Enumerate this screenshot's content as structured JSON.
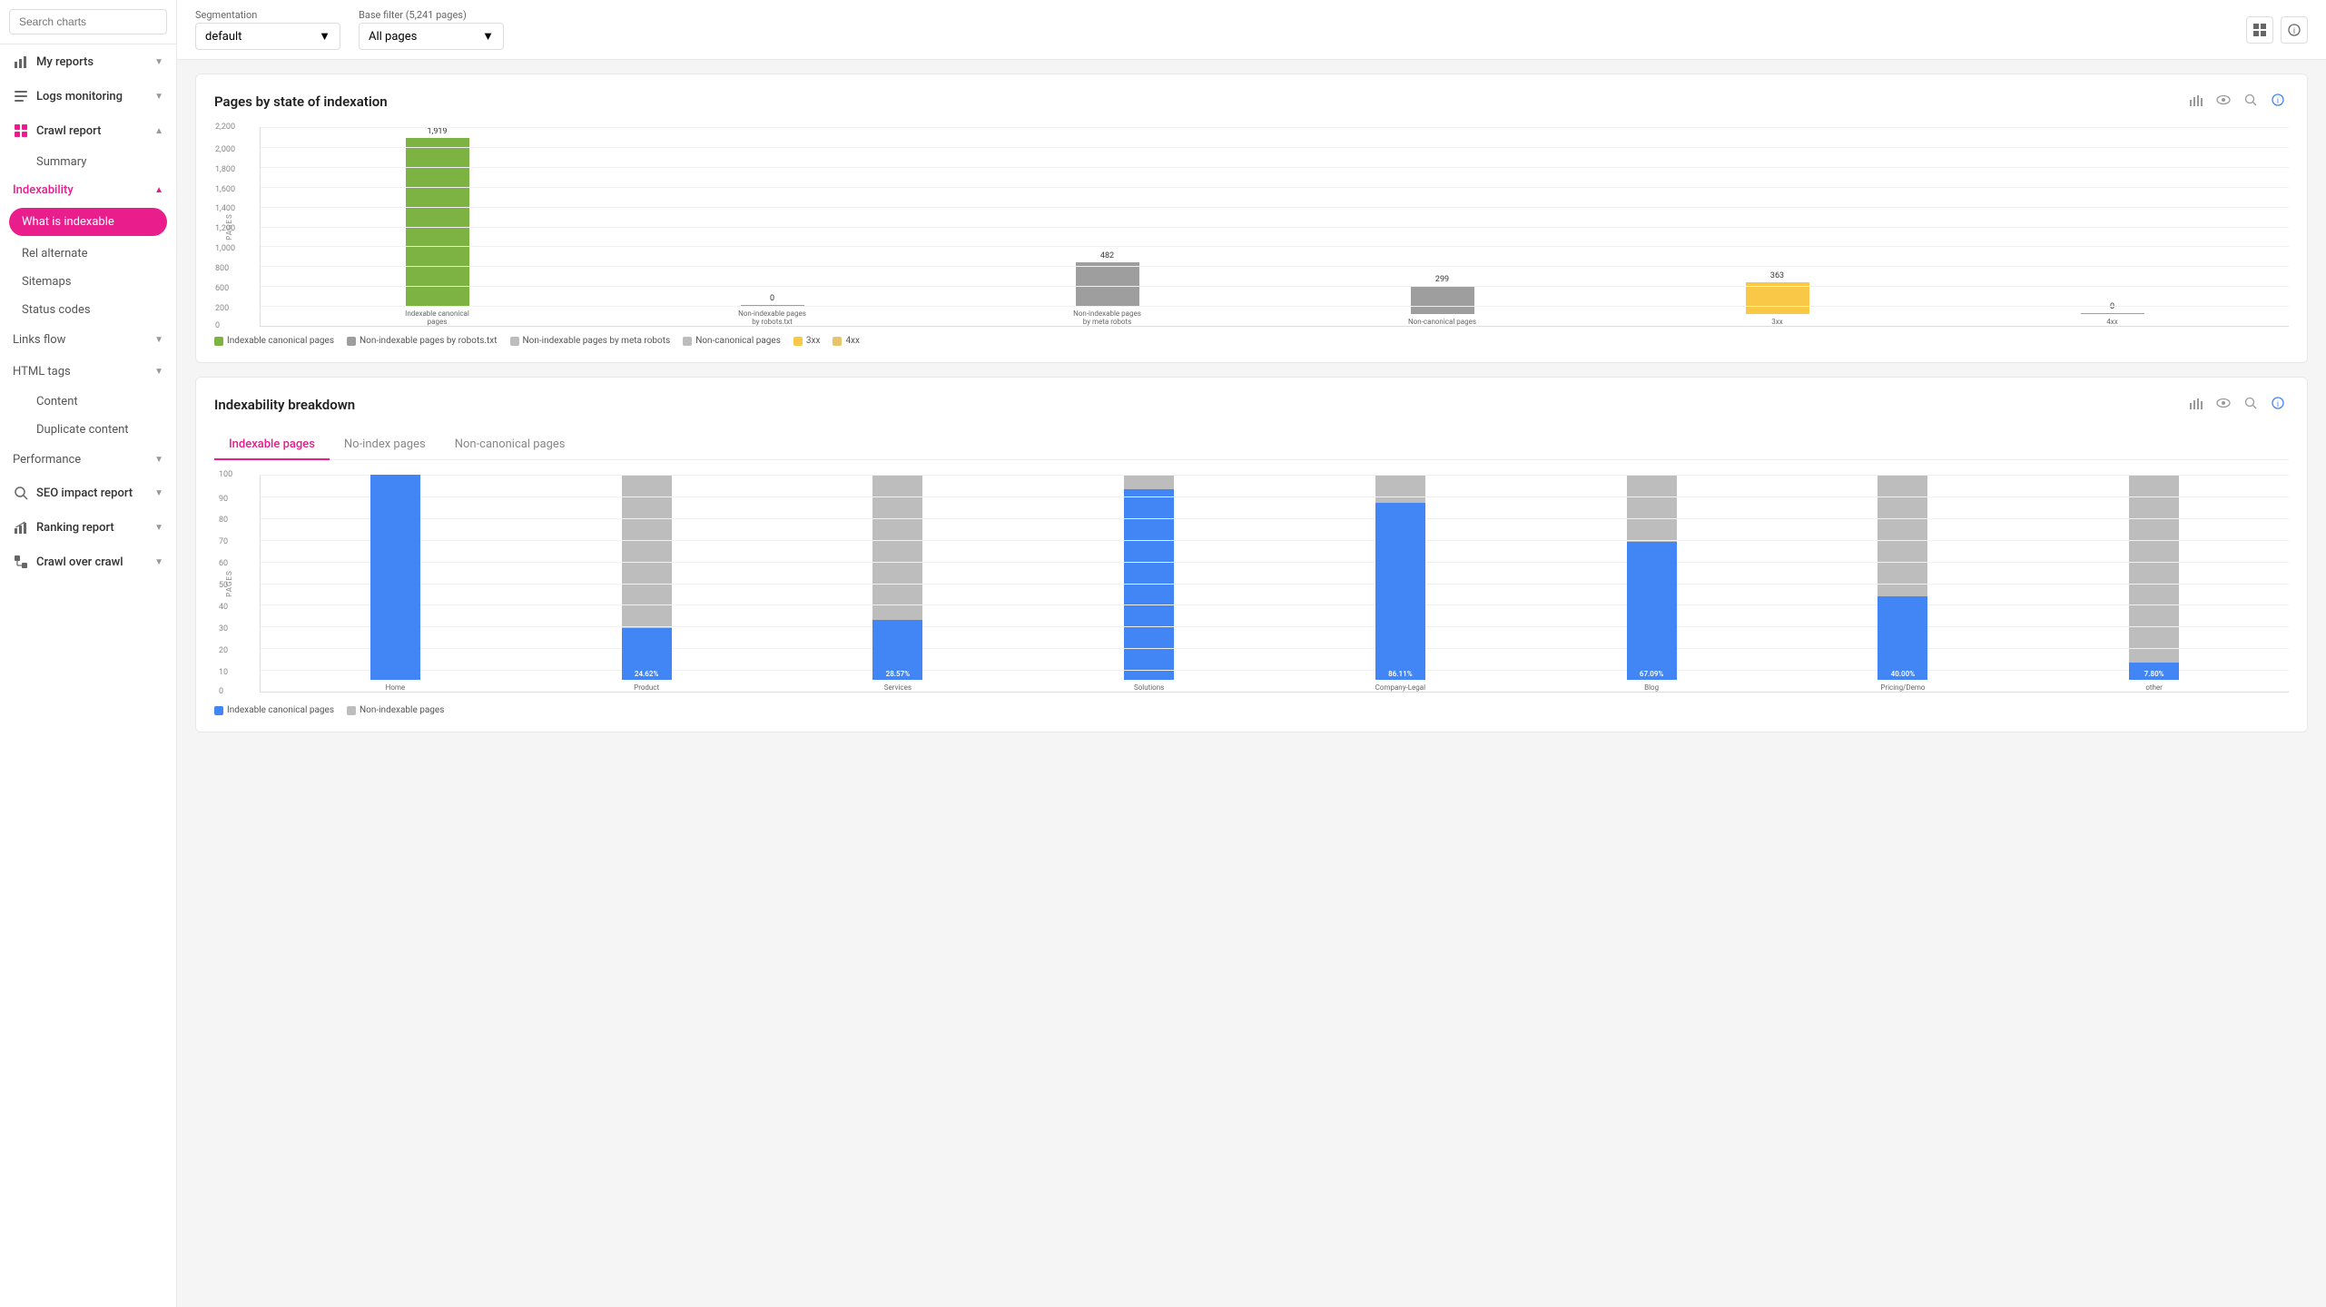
{
  "sidebar": {
    "search_placeholder": "Search charts",
    "nav_items": [
      {
        "id": "my-reports",
        "label": "My reports",
        "icon": "chart-icon",
        "has_children": true
      },
      {
        "id": "logs-monitoring",
        "label": "Logs monitoring",
        "icon": "logs-icon",
        "has_children": true
      },
      {
        "id": "crawl-report",
        "label": "Crawl report",
        "icon": "crawl-icon",
        "has_children": true,
        "expanded": true
      }
    ],
    "crawl_subitems": [
      {
        "id": "summary",
        "label": "Summary",
        "active": false
      },
      {
        "id": "indexability",
        "label": "Indexability",
        "active": true,
        "is_section": true
      },
      {
        "id": "what-is-indexable",
        "label": "What is indexable",
        "active": true,
        "pill": true
      },
      {
        "id": "rel-alternate",
        "label": "Rel alternate",
        "active": false
      },
      {
        "id": "sitemaps",
        "label": "Sitemaps",
        "active": false
      },
      {
        "id": "status-codes",
        "label": "Status codes",
        "active": false
      },
      {
        "id": "links-flow",
        "label": "Links flow",
        "has_children": true
      },
      {
        "id": "html-tags",
        "label": "HTML tags",
        "has_children": true
      },
      {
        "id": "content",
        "label": "Content"
      },
      {
        "id": "duplicate-content",
        "label": "Duplicate content"
      },
      {
        "id": "performance",
        "label": "Performance",
        "has_children": true
      },
      {
        "id": "seo-impact-report",
        "label": "SEO impact report",
        "icon": "seo-icon",
        "has_children": true
      },
      {
        "id": "ranking-report",
        "label": "Ranking report",
        "icon": "ranking-icon",
        "has_children": true
      },
      {
        "id": "crawl-over-crawl",
        "label": "Crawl over crawl",
        "icon": "crawl2-icon",
        "has_children": true
      }
    ]
  },
  "topbar": {
    "segmentation_label": "Segmentation",
    "segmentation_value": "default",
    "base_filter_label": "Base filter (5,241 pages)",
    "base_filter_value": "All pages",
    "icons": [
      "grid-icon",
      "info-icon"
    ]
  },
  "chart1": {
    "title": "Pages by state of indexation",
    "y_axis_title": "PAGES",
    "y_labels": [
      "0",
      "200",
      "400",
      "600",
      "800",
      "1,000",
      "1,200",
      "1,400",
      "1,600",
      "1,800",
      "2,000",
      "2,200"
    ],
    "bars": [
      {
        "label": "Indexable canonical pages",
        "value": 1919,
        "display": "1,919",
        "color": "#7cb342",
        "height_pct": 87
      },
      {
        "label": "Non-indexable pages by robots.txt",
        "value": 0,
        "display": "0",
        "color": "#9e9e9e",
        "height_pct": 0
      },
      {
        "label": "Non-indexable pages by meta robots",
        "value": 482,
        "display": "482",
        "color": "#9e9e9e",
        "height_pct": 22
      },
      {
        "label": "Non-canonical pages",
        "value": 299,
        "display": "299",
        "color": "#9e9e9e",
        "height_pct": 14
      },
      {
        "label": "3xx",
        "value": 363,
        "display": "363",
        "color": "#f9c846",
        "height_pct": 16
      },
      {
        "label": "4xx",
        "value": 0,
        "display": "0",
        "color": "#9e9e9e",
        "height_pct": 0
      }
    ],
    "legend": [
      {
        "label": "Indexable canonical pages",
        "color": "#7cb342"
      },
      {
        "label": "Non-indexable pages by robots.txt",
        "color": "#9e9e9e"
      },
      {
        "label": "Non-indexable pages by meta robots",
        "color": "#bdbdbd"
      },
      {
        "label": "Non-canonical pages",
        "color": "#bdbdbd"
      },
      {
        "label": "3xx",
        "color": "#f9c846"
      },
      {
        "label": "4xx",
        "color": "#e8c46a"
      }
    ]
  },
  "chart2": {
    "title": "Indexability breakdown",
    "tabs": [
      "Indexable pages",
      "No-index pages",
      "Non-canonical pages"
    ],
    "active_tab": 0,
    "y_labels": [
      "0",
      "10",
      "20",
      "30",
      "40",
      "50",
      "60",
      "70",
      "80",
      "90",
      "100"
    ],
    "y_axis_title": "PAGES",
    "bars": [
      {
        "label": "Home",
        "bottom_pct": 100,
        "top_pct": 0,
        "pct_label": null
      },
      {
        "label": "Product",
        "bottom_pct": 24.62,
        "top_pct": 75.38,
        "pct_label": "24.62%"
      },
      {
        "label": "Services",
        "bottom_pct": 28.57,
        "top_pct": 71.43,
        "pct_label": "28.57%"
      },
      {
        "label": "Solutions",
        "bottom_pct": 93,
        "top_pct": 7,
        "pct_label": null
      },
      {
        "label": "Company-Legal",
        "bottom_pct": 86.11,
        "top_pct": 13.89,
        "pct_label": "86.11%"
      },
      {
        "label": "Blog",
        "bottom_pct": 67.09,
        "top_pct": 32.91,
        "pct_label": "67.09%"
      },
      {
        "label": "Pricing/Demo",
        "bottom_pct": 40.0,
        "top_pct": 60.0,
        "pct_label": "40.00%"
      },
      {
        "label": "other",
        "bottom_pct": 7.8,
        "top_pct": 92.2,
        "pct_label": "7.80%"
      }
    ],
    "legend": [
      {
        "label": "Indexable canonical pages",
        "color": "#4285f4"
      },
      {
        "label": "Non-indexable pages",
        "color": "#bdbdbd"
      }
    ]
  }
}
